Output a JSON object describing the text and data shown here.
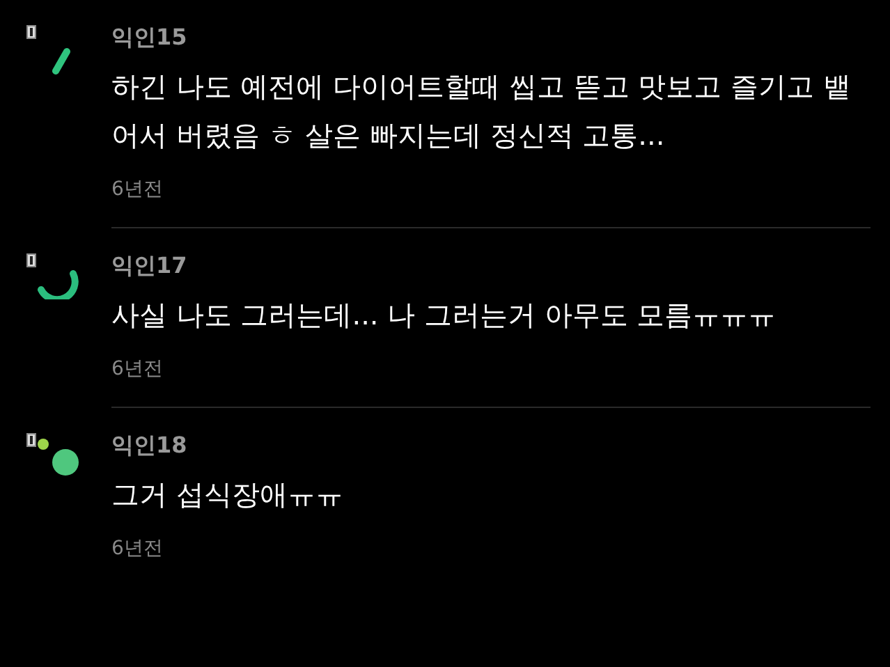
{
  "comments": [
    {
      "kind": "bar",
      "author": "익인15",
      "text": "하긴 나도 예전에 다이어트할때 씹고 뜯고 맛보고 즐기고 뱉어서 버렸음 ㅎ 살은 빠지는데 정신적 고통...",
      "time": "6년전"
    },
    {
      "kind": "arc",
      "author": "익인17",
      "text": "사실 나도 그러는데... 나 그러는거 아무도 모름ㅠㅠㅠ",
      "time": "6년전"
    },
    {
      "kind": "dots",
      "author": "익인18",
      "text": "그거 섭식장애ㅠㅠ",
      "time": "6년전"
    }
  ]
}
